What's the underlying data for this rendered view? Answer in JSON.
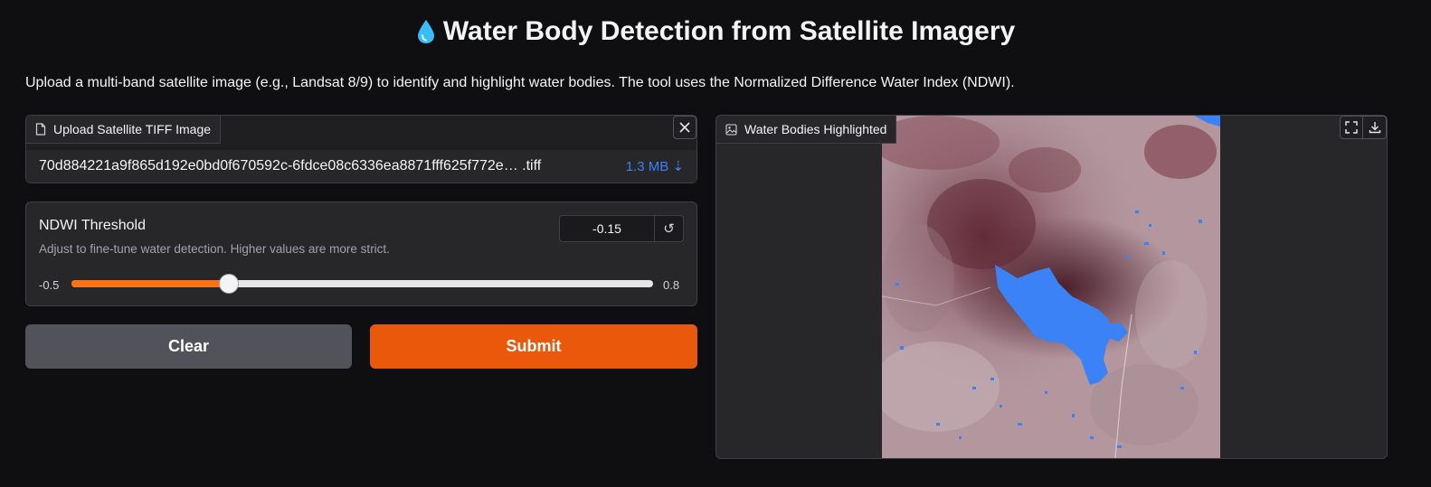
{
  "header": {
    "icon": "water-drop-icon",
    "title": "Water Body Detection from Satellite Imagery",
    "description": "Upload a multi-band satellite image (e.g., Landsat 8/9) to identify and highlight water bodies. The tool uses the Normalized Difference Water Index (NDWI)."
  },
  "upload": {
    "label": "Upload Satellite TIFF Image",
    "icon": "file-icon",
    "file_name": "70d884221a9f865d192e0bd0f670592c-6fdce08c6336ea8871fff625f772e… .tiff",
    "file_size": "1.3 MB",
    "close_icon": "close-icon"
  },
  "slider": {
    "label": "NDWI Threshold",
    "info": "Adjust to fine-tune water detection. Higher values are more strict.",
    "value": "-0.15",
    "min": "-0.5",
    "max": "0.8",
    "fraction": 0.27,
    "reset_icon": "reset-icon"
  },
  "buttons": {
    "clear": "Clear",
    "submit": "Submit"
  },
  "output": {
    "label": "Water Bodies Highlighted",
    "icon": "image-icon",
    "fullscreen_icon": "fullscreen-icon",
    "download_icon": "download-icon"
  },
  "colors": {
    "accent": "#ea580c",
    "water_highlight": "#3b82f6",
    "background": "#0f0f11"
  }
}
